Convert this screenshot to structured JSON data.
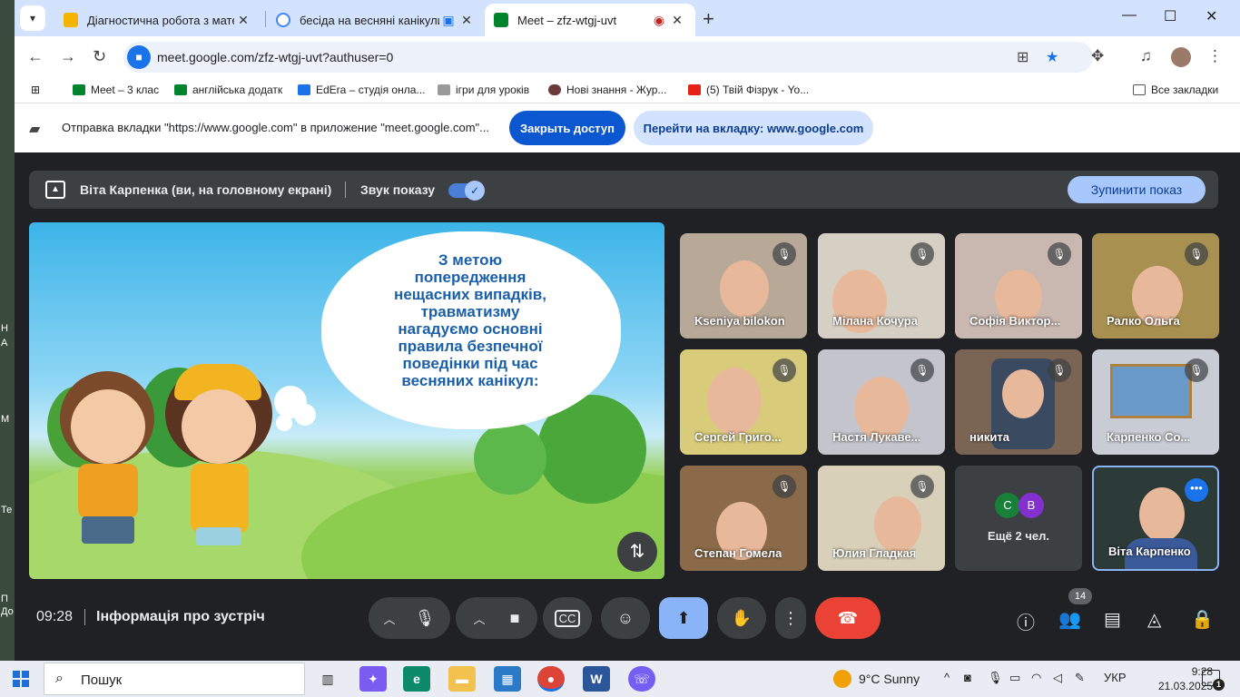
{
  "desktop_side": [
    "Н",
    "А",
    "М",
    "Те",
    "П",
    "До"
  ],
  "tabs": [
    {
      "title": "Діагностична робота з матема",
      "favicon": "drive-icon"
    },
    {
      "title": "бесіда на весняні канікули",
      "favicon": "google-icon"
    },
    {
      "title": "Meet – zfz-wtgj-uvt",
      "favicon": "meet-icon",
      "active": true
    }
  ],
  "address": {
    "url": "meet.google.com/zfz-wtgj-uvt?authuser=0"
  },
  "bookmarks": [
    "Meet – 3 клас",
    "англійська додатк",
    "EdEra – студія онла...",
    "ігри для уроків",
    "Нові знання - Жур...",
    "(5) Твій Фізрук - Yo..."
  ],
  "all_bookmarks": "Все закладки",
  "infobar": {
    "message": "Отправка вкладки \"https://www.google.com\" в приложение \"meet.google.com\"...",
    "stop_access": "Закрыть доступ",
    "go_to_tab": "Перейти на вкладку: www.google.com"
  },
  "presenting": {
    "who": "Віта Карпенка (ви, на головному екрані)",
    "share_audio": "Звук показу",
    "stop": "Зупинити показ"
  },
  "slide": {
    "lines": [
      "З метою",
      "попередження",
      "нещасних випадків,",
      "травматизму",
      "нагадуємо основні",
      "правила безпечної",
      "поведінки під час",
      "весняних канікул:"
    ]
  },
  "participants": [
    {
      "name": "Kseniya bilokon",
      "muted": true
    },
    {
      "name": "Мілана Кочура",
      "muted": true
    },
    {
      "name": "Софія Виктор...",
      "muted": true
    },
    {
      "name": "Ралко Ольга",
      "muted": true
    },
    {
      "name": "Сергей Григо...",
      "muted": true
    },
    {
      "name": "Настя Лукаве...",
      "muted": true
    },
    {
      "name": "никита",
      "muted": true
    },
    {
      "name": "Карпенко Со...",
      "muted": true
    },
    {
      "name": "Степан Гомела",
      "muted": true
    },
    {
      "name": "Юлия Гладкая",
      "muted": true
    }
  ],
  "more_tile": {
    "avatars": [
      "C",
      "B"
    ],
    "label": "Ещё 2 чел."
  },
  "self_tile": {
    "name": "Віта Карпенко"
  },
  "controls": {
    "time": "09:28",
    "meeting_info": "Інформація про зустріч",
    "people_count": "14"
  },
  "taskbar": {
    "search_placeholder": "Пошук",
    "temperature": "9°C",
    "condition": "Sunny",
    "lang": "УКР",
    "time": "9:28",
    "date": "21.03.2025",
    "notifications": "1"
  },
  "colors": {
    "meet_bg": "#202124",
    "end_call": "#ea4335",
    "accent": "#0b57d0",
    "tab_strip": "#d3e3fd"
  }
}
